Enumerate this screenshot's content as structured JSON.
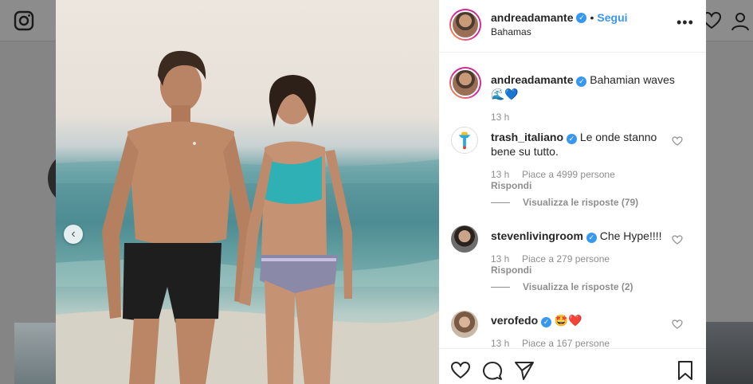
{
  "post": {
    "author": "andreadamante",
    "follow_label": "Segui",
    "separator": "•",
    "location": "Bahamas",
    "more_label": "•••"
  },
  "caption": {
    "author": "andreadamante",
    "text": "Bahamian waves",
    "emoji": "🌊💙",
    "time": "13 h"
  },
  "comments": [
    {
      "user": "trash_italiano",
      "text_line1": "Le onde stanno",
      "text_line2": "bene su tutto.",
      "time": "13 h",
      "likes": "Piace a 4999 persone",
      "reply": "Rispondi",
      "view_replies": "Visualizza le risposte (79)"
    },
    {
      "user": "stevenlivingroom",
      "text_line1": "Che Hype!!!!",
      "time": "13 h",
      "likes": "Piace a 279 persone",
      "reply": "Rispondi",
      "view_replies": "Visualizza le risposte (2)"
    },
    {
      "user": "verofedo",
      "text_line1": "🤩❤️",
      "time": "13 h",
      "likes": "Piace a 167 persone"
    }
  ],
  "carousel": {
    "prev_label": "‹"
  },
  "icons": {
    "instagram": "instagram-icon",
    "like": "heart-icon",
    "comment": "comment-icon",
    "share": "share-icon",
    "save": "bookmark-icon",
    "prev": "chevron-left-icon"
  },
  "colors": {
    "link": "#3897f0",
    "verified": "#3897f0",
    "text": "#262626",
    "muted": "#8e8e8e"
  }
}
